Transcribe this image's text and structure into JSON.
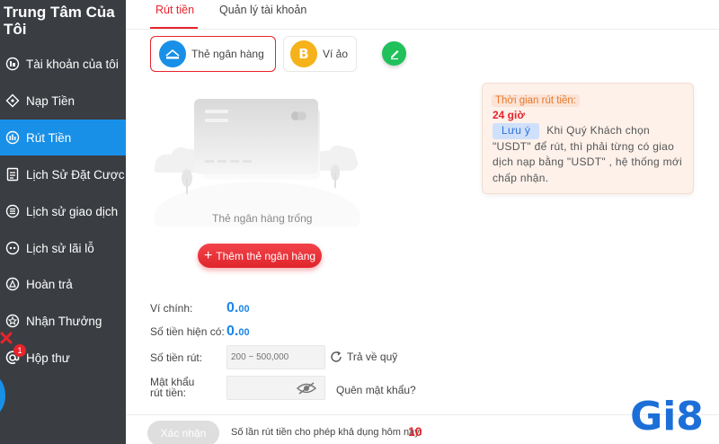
{
  "sidebar": {
    "title": "Trung Tâm Của Tôi",
    "items": [
      {
        "label": "Tài khoản của tôi",
        "icon": "account-icon"
      },
      {
        "label": "Nạp Tiền",
        "icon": "deposit-icon"
      },
      {
        "label": "Rút Tiền",
        "icon": "withdraw-icon",
        "active": true
      },
      {
        "label": "Lịch Sử Đặt Cược",
        "icon": "bet-history-icon"
      },
      {
        "label": "Lịch sử giao dịch",
        "icon": "transaction-history-icon"
      },
      {
        "label": "Lịch sử lãi lỗ",
        "icon": "profit-loss-icon"
      },
      {
        "label": "Hoàn trả",
        "icon": "rebate-icon"
      },
      {
        "label": "Nhận Thưởng",
        "icon": "reward-icon"
      },
      {
        "label": "Hộp thư",
        "icon": "mailbox-icon"
      }
    ],
    "mail_badge": "1"
  },
  "tabs": [
    {
      "label": "Rút tiền",
      "active": true
    },
    {
      "label": "Quản lý tài khoản",
      "active": false
    }
  ],
  "methods": [
    {
      "label": "Thẻ ngân hàng",
      "icon": "bank-card-icon",
      "active": true
    },
    {
      "label": "Ví ảo",
      "icon": "bitcoin-icon",
      "active": false
    }
  ],
  "empty_card": {
    "text": "Thẻ ngân hàng trống",
    "add_button": "Thêm thẻ ngân hàng"
  },
  "info": {
    "time_label": "Thời gian rút tiền:",
    "hours": "24 giờ",
    "note_tag": "Lưu ý",
    "note_text": "Khi Quý Khách chọn \"USDT\" để rút, thì phải từng có giao dịch nạp bằng \"USDT\" , hệ thống mới chấp nhận."
  },
  "form": {
    "main_wallet_label": "Ví chính:",
    "main_wallet_int": "0.",
    "main_wallet_dec": "00",
    "balance_label": "Số tiền hiện có:",
    "balance_int": "0.",
    "balance_dec": "00",
    "amount_label": "Số tiền rút:",
    "amount_placeholder": "200 ~ 500,000",
    "return_label": "Trả về quỹ",
    "password_label": "Mật khẩu rút tiền:",
    "forgot_label": "Quên mật khẩu?"
  },
  "footer": {
    "confirm_label": "Xác nhận",
    "limit_text": "Số lần rút tiền cho phép khả dụng hôm nay:",
    "limit_value": "10"
  },
  "colors": {
    "accent_red": "#e8232b",
    "active_blue": "#1890e8",
    "sidebar_bg": "#3a3d42",
    "value_blue": "#1a85e8",
    "edit_green": "#20c05a"
  }
}
